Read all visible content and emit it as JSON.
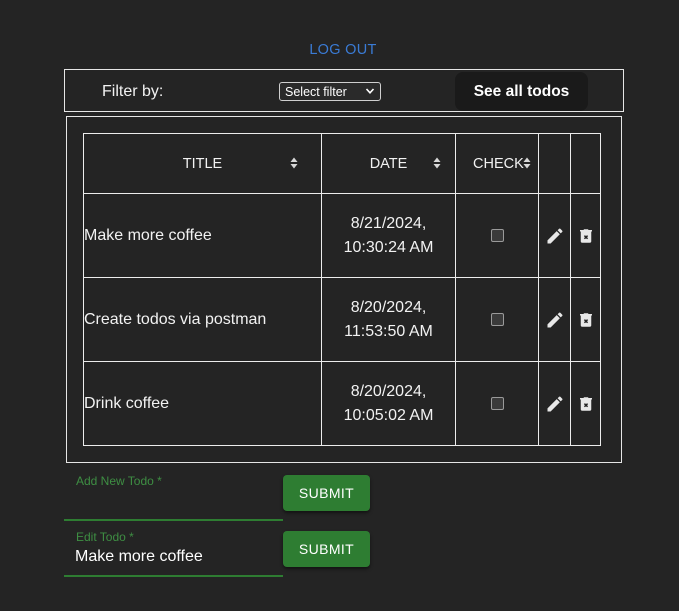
{
  "header": {
    "logout_label": "LOG OUT"
  },
  "filter": {
    "label": "Filter by:",
    "selected": "Select filter",
    "see_all_label": "See all todos"
  },
  "table": {
    "headers": [
      "TITLE",
      "DATE",
      "CHECK"
    ],
    "rows": [
      {
        "title": "Make more coffee",
        "date_line1": "8/21/2024,",
        "date_line2": "10:30:24 AM",
        "checked": false
      },
      {
        "title": "Create todos via postman",
        "date_line1": "8/20/2024,",
        "date_line2": "11:53:50 AM",
        "checked": false
      },
      {
        "title": "Drink coffee",
        "date_line1": "8/20/2024,",
        "date_line2": "10:05:02 AM",
        "checked": false
      }
    ],
    "icons": {
      "edit": "pencil-icon",
      "delete": "trash-icon",
      "sort": "sort-icon"
    }
  },
  "add_form": {
    "label": "Add New Todo *",
    "value": "",
    "submit_label": "SUBMIT"
  },
  "edit_form": {
    "label": "Edit Todo *",
    "value": "Make more coffee",
    "submit_label": "SUBMIT"
  },
  "colors": {
    "accent_green": "#2e7d32",
    "link_blue": "#3a7bd5",
    "background": "#242424"
  }
}
